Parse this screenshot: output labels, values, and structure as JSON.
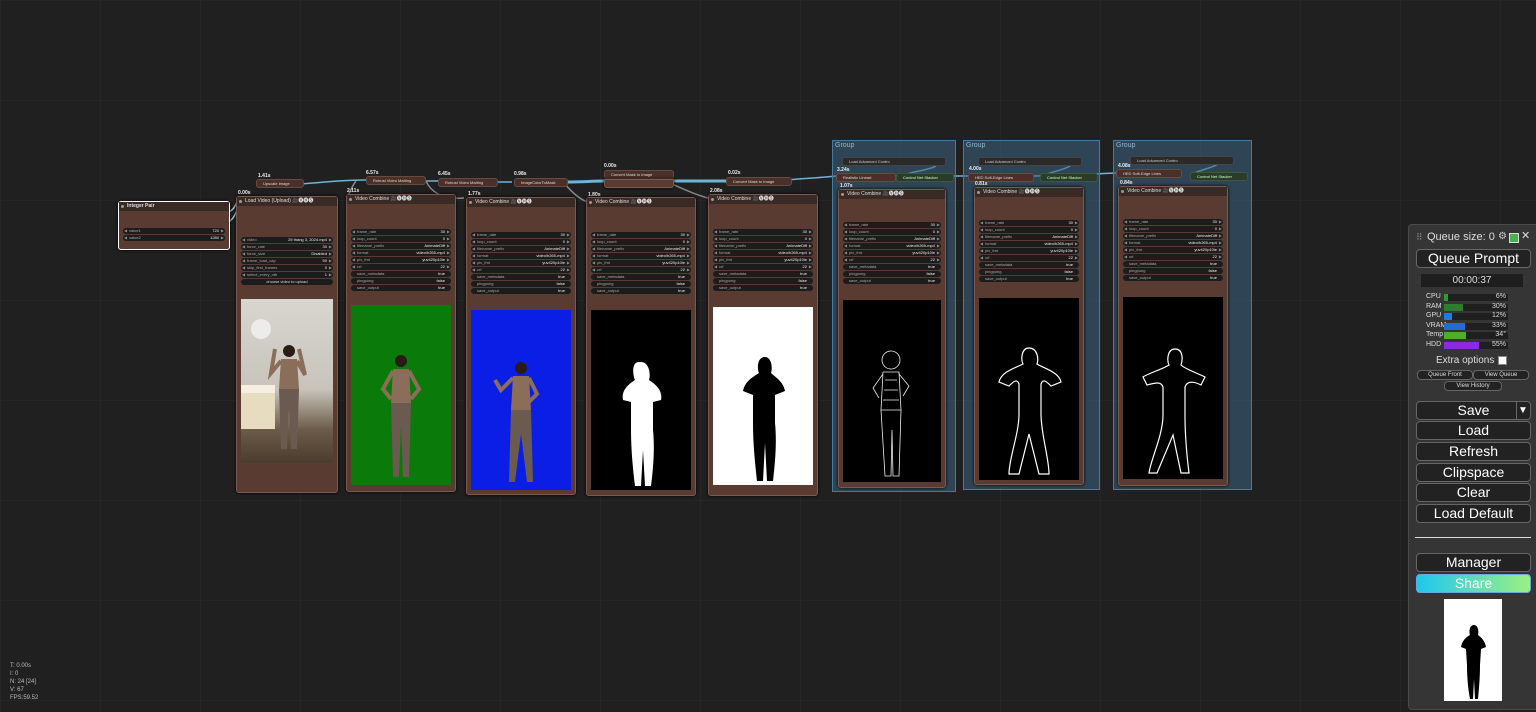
{
  "canvas": {
    "status_lines": [
      "T: 0.00s",
      "I: 0",
      "N: 24 [24]",
      "V: 67",
      "FPS:59.52"
    ]
  },
  "nodes": {
    "integer_pair": {
      "title": "Integer Pair",
      "rows": [
        {
          "k": "value1",
          "v": "720"
        },
        {
          "k": "value2",
          "v": "1280"
        }
      ]
    },
    "upscale_image": {
      "title": "Upscale Image",
      "time": "1.41s"
    },
    "rvm1": {
      "title": "Robust Video Matting",
      "time": "6.57s"
    },
    "rvm2": {
      "title": "Robust Video Matting",
      "time": "6.45s"
    },
    "image_color_to_mask": {
      "title": "ImageColorToMask",
      "time": "0.98s"
    },
    "convert_mask_1": {
      "title": "Convert Mask to Image",
      "time": "0.00s"
    },
    "convert_mask_2": {
      "title": "Convert Mask to Image",
      "time": "0.02s"
    },
    "load_video": {
      "title": "Load Video (Upload) 🎥🅥🅗🅢",
      "time": "0.00s",
      "rows": [
        {
          "k": "video",
          "v": "29 thang 3, 2024.mp4"
        },
        {
          "k": "force_rate",
          "v": "30"
        },
        {
          "k": "force_size",
          "v": "Disabled"
        },
        {
          "k": "frame_load_cap",
          "v": "50"
        },
        {
          "k": "skip_first_frames",
          "v": "0"
        },
        {
          "k": "select_every_nth",
          "v": "1"
        }
      ],
      "upload_label": "choose video to upload"
    },
    "vc1": {
      "title": "Video Combine 🎥🅥🅗🅢",
      "time": "2.11s"
    },
    "vc2": {
      "title": "Video Combine 🎥🅥🅗🅢",
      "time": "1.77s"
    },
    "vc3": {
      "title": "Video Combine 🎥🅥🅗🅢",
      "time": "1.80s"
    },
    "vc4": {
      "title": "Video Combine 🎥🅥🅗🅢",
      "time": "2.08s"
    },
    "vc5": {
      "title": "Video Combine 🎥🅥🅗🅢",
      "time": "1.07s"
    },
    "vc6": {
      "title": "Video Combine 🎥🅥🅗🅢",
      "time": "0.81s"
    },
    "vc7": {
      "title": "Video Combine 🎥🅥🅗🅢",
      "time": "0.84s"
    },
    "vc_rows": [
      {
        "k": "frame_rate",
        "v": "30"
      },
      {
        "k": "loop_count",
        "v": "0"
      },
      {
        "k": "filename_prefix",
        "v": "AnimateDiff"
      },
      {
        "k": "format",
        "v": "video/h265-mp4"
      },
      {
        "k": "pix_fmt",
        "v": "yuv420p10le"
      },
      {
        "k": "crf",
        "v": "22"
      },
      {
        "k": "save_metadata",
        "v": "true"
      },
      {
        "k": "pingpong",
        "v": "false"
      },
      {
        "k": "save_output",
        "v": "true"
      }
    ]
  },
  "groups": [
    {
      "title": "Group",
      "load_advanced": "Load Advanced Contro",
      "preprocessor": "Realistic Lineart",
      "stacker": "Control Net Stacker",
      "time": "3.24s"
    },
    {
      "title": "Group",
      "load_advanced": "Load Advanced Contro",
      "preprocessor": "HED Soft-Edge Lines",
      "stacker": "Control Net Stacker",
      "time": "4.00s"
    },
    {
      "title": "Group",
      "load_advanced": "Load Advanced Contro",
      "preprocessor": "HED Soft-Edge Lines",
      "stacker": "Control Net Stacker",
      "time": "4.08s"
    }
  ],
  "panel": {
    "queue_size": "Queue size: 0",
    "queue_prompt": "Queue Prompt",
    "elapsed": "00:00:37",
    "meters": [
      {
        "label": "CPU",
        "pct": "6%",
        "value": 6,
        "color": "#2e9b2e"
      },
      {
        "label": "RAM",
        "pct": "30%",
        "value": 30,
        "color": "#2e7d2e"
      },
      {
        "label": "GPU",
        "pct": "12%",
        "value": 12,
        "color": "#1e7be0"
      },
      {
        "label": "VRAM",
        "pct": "33%",
        "value": 33,
        "color": "#1e6fd0"
      },
      {
        "label": "Temp",
        "pct": "34°",
        "value": 34,
        "color": "#4caf2a"
      },
      {
        "label": "HDD",
        "pct": "55%",
        "value": 55,
        "color": "#8a2be2"
      }
    ],
    "extra_options": "Extra options",
    "queue_front": "Queue Front",
    "view_queue": "View Queue",
    "view_history": "View History",
    "save": "Save",
    "load": "Load",
    "refresh": "Refresh",
    "clipspace": "Clipspace",
    "clear": "Clear",
    "load_default": "Load Default",
    "manager": "Manager",
    "share": "Share"
  }
}
